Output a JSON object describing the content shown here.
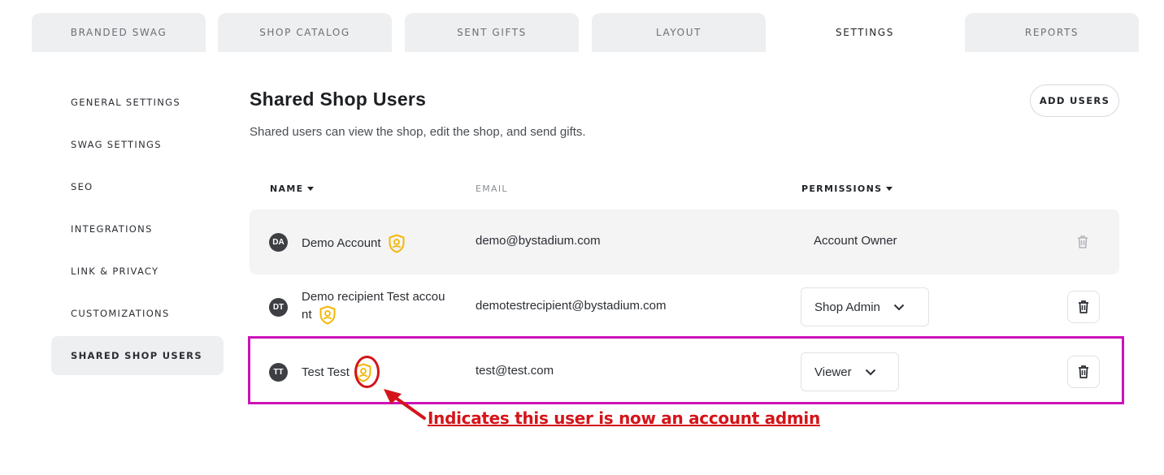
{
  "tabs": [
    {
      "label": "BRANDED SWAG"
    },
    {
      "label": "SHOP CATALOG"
    },
    {
      "label": "SENT GIFTS"
    },
    {
      "label": "LAYOUT"
    },
    {
      "label": "SETTINGS"
    },
    {
      "label": "REPORTS"
    }
  ],
  "sidebar": {
    "items": [
      {
        "label": "GENERAL SETTINGS"
      },
      {
        "label": "SWAG SETTINGS"
      },
      {
        "label": "SEO"
      },
      {
        "label": "INTEGRATIONS"
      },
      {
        "label": "LINK & PRIVACY"
      },
      {
        "label": "CUSTOMIZATIONS"
      },
      {
        "label": "SHARED SHOP USERS"
      }
    ]
  },
  "main": {
    "title": "Shared Shop Users",
    "subtitle": "Shared users can view the shop, edit the shop, and send gifts.",
    "add_users_label": "ADD USERS",
    "columns": {
      "name": "NAME",
      "email": "EMAIL",
      "permissions": "PERMISSIONS"
    },
    "users": [
      {
        "initials": "DA",
        "name": "Demo Account",
        "email": "demo@bystadium.com",
        "permission": "Account Owner"
      },
      {
        "initials": "DT",
        "name_line1": "Demo recipient Test accou",
        "name_line2": "nt",
        "email": "demotestrecipient@bystadium.com",
        "permission": "Shop Admin"
      },
      {
        "initials": "TT",
        "name": "Test Test",
        "email": "test@test.com",
        "permission": "Viewer"
      }
    ]
  },
  "annotation": {
    "text": "Indicates this user is now an account admin"
  },
  "colors": {
    "admin_badge": "#f2b705",
    "highlight": "#cc12b8",
    "annotation": "#d4141a"
  }
}
